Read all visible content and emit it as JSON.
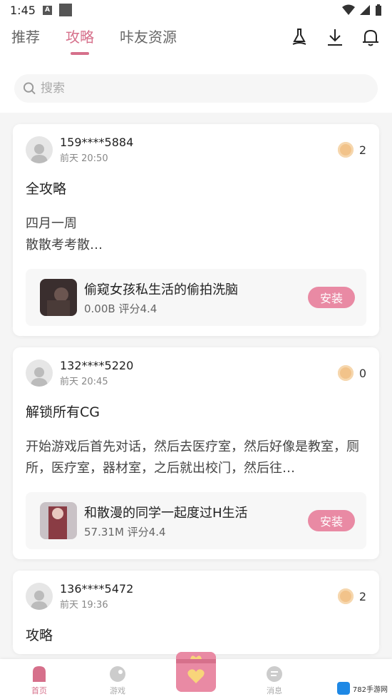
{
  "status_bar": {
    "time": "1:45",
    "a_badge": "A"
  },
  "tabs": [
    {
      "label": "推荐",
      "active": false
    },
    {
      "label": "攻略",
      "active": true
    },
    {
      "label": "咔友资源",
      "active": false
    }
  ],
  "top_icons": [
    "broom-icon",
    "download-icon",
    "bell-icon"
  ],
  "search": {
    "placeholder": "搜索"
  },
  "posts": [
    {
      "user": "159****5884",
      "time": "前天 20:50",
      "likes": "2",
      "title": "全攻略",
      "body": "四月一周\n散散考考散…",
      "app": {
        "name": "偷窥女孩私生活的偷拍洗脑",
        "size": "0.00B",
        "rating": "评分4.4"
      },
      "install_label": "安装"
    },
    {
      "user": "132****5220",
      "time": "前天 20:45",
      "likes": "0",
      "title": "解锁所有CG",
      "body": "开始游戏后首先对话，然后去医疗室，然后好像是教室，厕所，医疗室，器材室，之后就出校门，然后往…",
      "app": {
        "name": "和散漫的同学一起度过H生活",
        "size": "57.31M",
        "rating": "评分4.4"
      },
      "install_label": "安装"
    },
    {
      "user": "136****5472",
      "time": "前天 19:36",
      "likes": "2",
      "title": "攻略"
    }
  ],
  "bottom_nav": [
    {
      "label": "首页",
      "active": true
    },
    {
      "label": "游戏",
      "active": false
    },
    {
      "label": "消息",
      "active": false
    }
  ],
  "watermark": {
    "text": "782手游网"
  },
  "colors": {
    "accent": "#d6708b",
    "install": "#e98aa4",
    "coin": "#f2c38a"
  }
}
